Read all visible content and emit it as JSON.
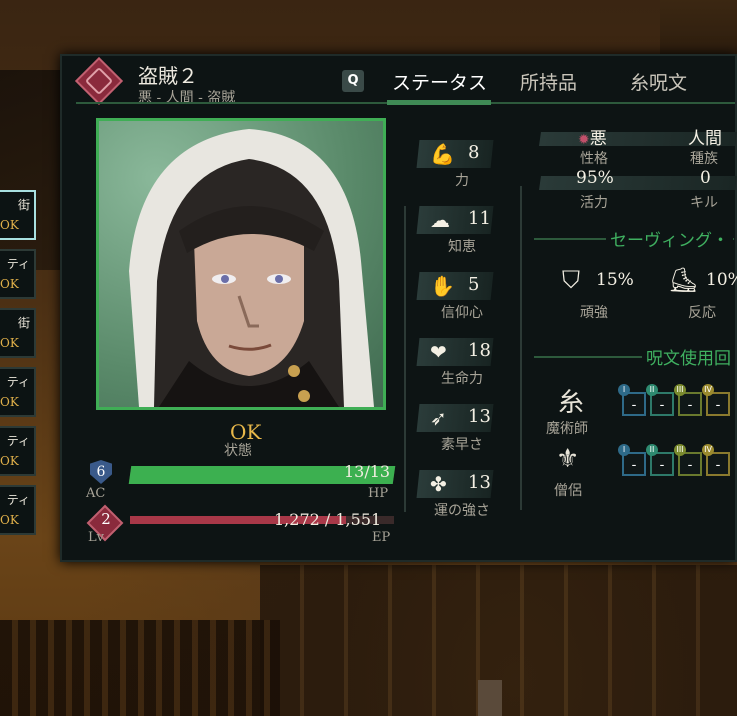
{
  "header": {
    "name": "盗賊２",
    "subtitle": "悪 - 人間 - 盗賊",
    "tab_key": "Q",
    "tabs": [
      "ステータス",
      "所持品",
      "呪文"
    ]
  },
  "party": [
    {
      "label": "街",
      "state": "OK",
      "active": true
    },
    {
      "label": "ティ",
      "state": "OK"
    },
    {
      "label": "街",
      "state": "OK"
    },
    {
      "label": "ティ",
      "state": "OK"
    },
    {
      "label": "ティ",
      "state": "OK"
    },
    {
      "label": "ティ",
      "state": "OK"
    }
  ],
  "status": {
    "value": "OK",
    "label": "状態"
  },
  "ac": {
    "value": "6",
    "label": "AC"
  },
  "hp": {
    "value": "13/13",
    "label": "HP",
    "fraction": 1.0
  },
  "level": {
    "value": "2",
    "label": "Lv"
  },
  "ep": {
    "value": "1,272 / 1,551",
    "label": "EP",
    "fraction": 0.82
  },
  "attributes": [
    {
      "icon": "strength-icon",
      "value": "8",
      "label": "力"
    },
    {
      "icon": "brain-icon",
      "value": "11",
      "label": "知恵"
    },
    {
      "icon": "faith-icon",
      "value": "5",
      "label": "信仰心"
    },
    {
      "icon": "heart-icon",
      "value": "18",
      "label": "生命力"
    },
    {
      "icon": "agility-icon",
      "value": "13",
      "label": "素早さ"
    },
    {
      "icon": "clover-icon",
      "value": "13",
      "label": "運の強さ"
    }
  ],
  "info": {
    "alignment": {
      "value": "悪",
      "label": "性格"
    },
    "race": {
      "value": "人間",
      "label": "種族"
    },
    "vitality": {
      "value": "95%",
      "label": "活力"
    },
    "kills": {
      "value": "0",
      "label": "キル"
    }
  },
  "saving": {
    "title": "セーヴィング・",
    "items": [
      {
        "icon": "shield-icon",
        "value": "15%",
        "label": "頑強"
      },
      {
        "icon": "boot-icon",
        "value": "10%",
        "label": "反応"
      }
    ]
  },
  "spells": {
    "title": "呪文使用回",
    "schools": [
      {
        "icon": "mage-icon",
        "label": "魔術師",
        "slots": [
          "-",
          "-",
          "-",
          "-"
        ]
      },
      {
        "icon": "priest-icon",
        "label": "僧侶",
        "slots": [
          "-",
          "-",
          "-",
          "-"
        ]
      }
    ],
    "levels": [
      "I",
      "II",
      "III",
      "IV"
    ]
  },
  "colors": {
    "accent": "#3fae55",
    "hp": "#3cb050",
    "ep": "#a83848",
    "ok": "#e8b84a"
  }
}
